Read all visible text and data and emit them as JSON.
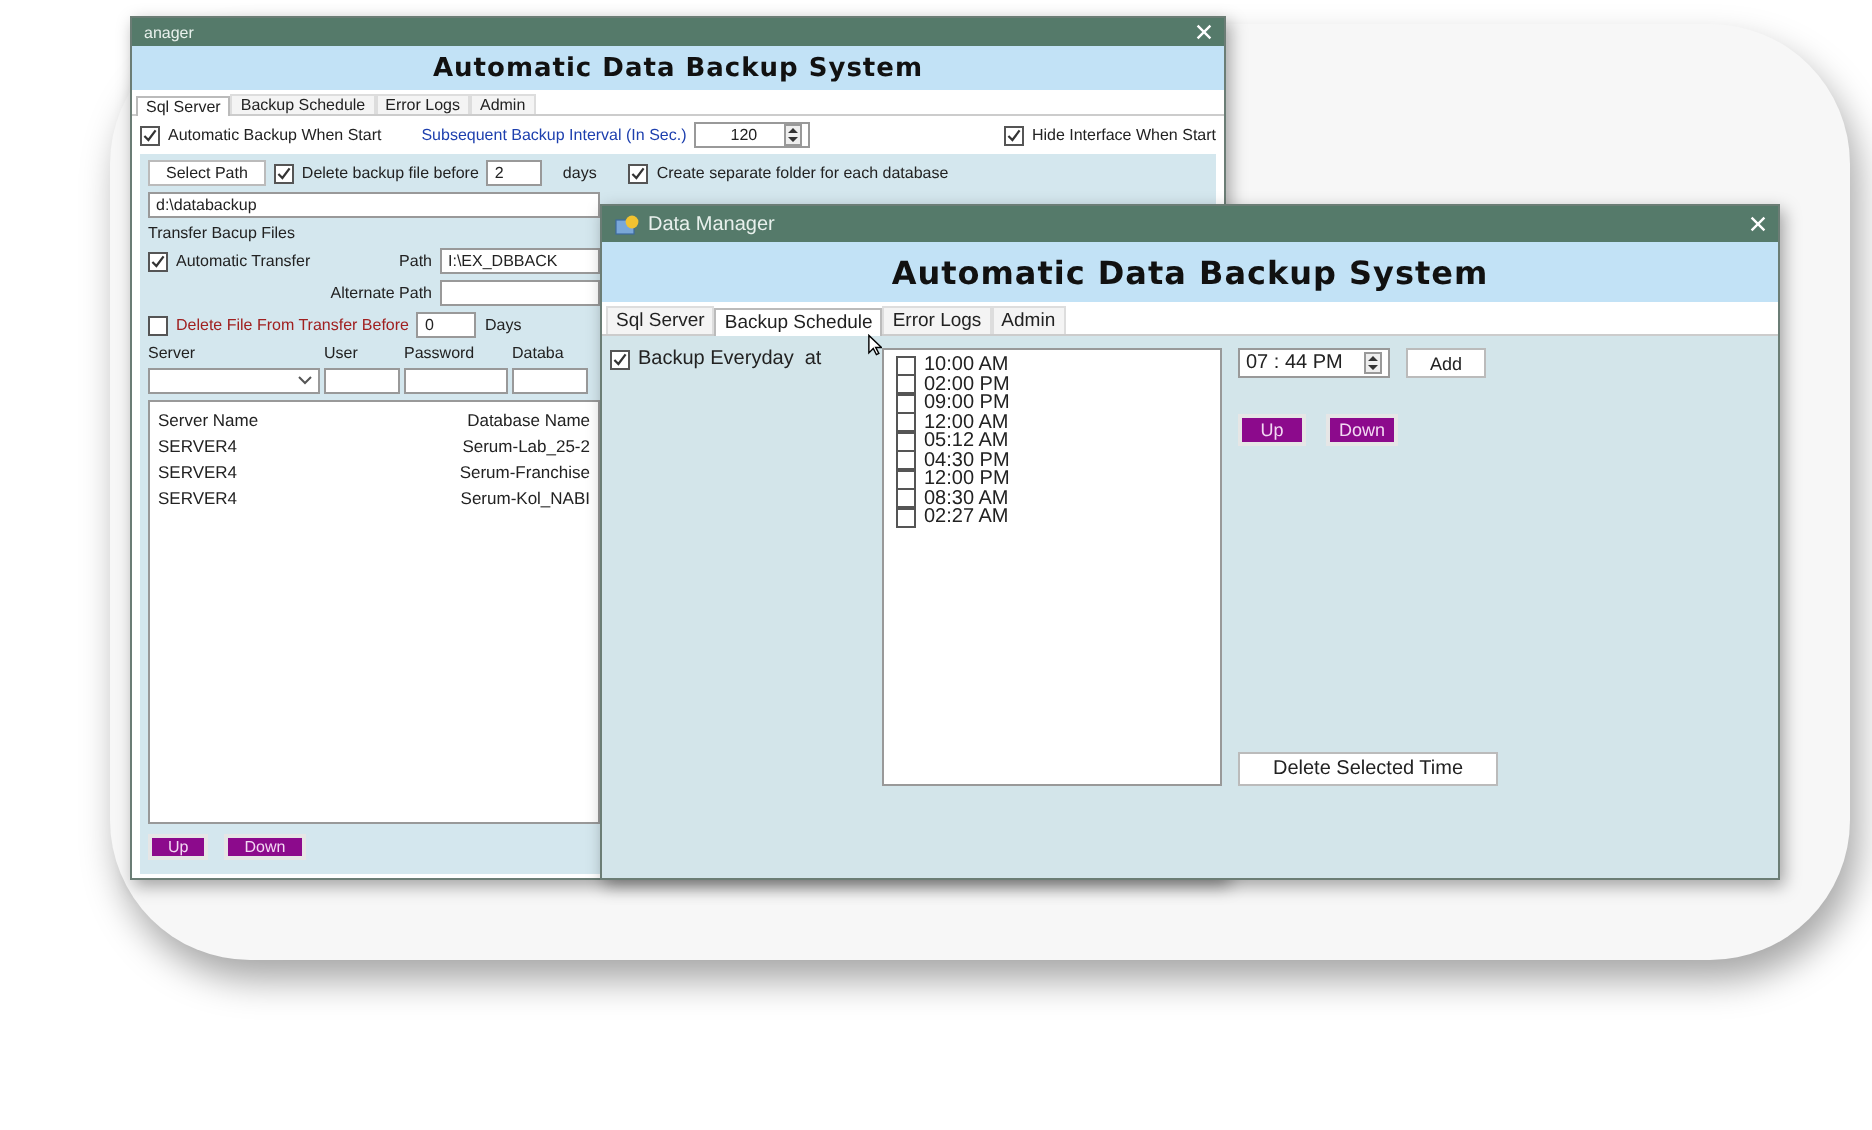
{
  "back_window": {
    "title": "anager",
    "heading": "Automatic Data Backup System",
    "tabs": [
      {
        "label": "Sql Server",
        "selected": true
      },
      {
        "label": "Backup Schedule",
        "selected": false
      },
      {
        "label": "Error Logs",
        "selected": false
      },
      {
        "label": "Admin",
        "selected": false
      }
    ],
    "auto_backup": {
      "label": "Automatic Backup When Start",
      "checked": true
    },
    "interval": {
      "label": "Subsequent Backup Interval (In Sec.)",
      "value": "120"
    },
    "hide_interface": {
      "label": "Hide Interface When Start",
      "checked": true
    },
    "select_path_button": "Select Path",
    "delete_before": {
      "label": "Delete backup file before",
      "checked": true,
      "value": "2",
      "unit": "days"
    },
    "separate_folder": {
      "label": "Create separate folder for each database",
      "checked": true
    },
    "backup_path": "d:\\databackup",
    "transfer": {
      "heading": "Transfer Bacup Files",
      "auto": {
        "label": "Automatic Transfer",
        "checked": true
      },
      "path_label": "Path",
      "path": "I:\\EX_DBBACK",
      "alternate_label": "Alternate Path"
    },
    "delete_transfer": {
      "label": "Delete File From Transfer Before",
      "checked": false,
      "value": "0",
      "unit": "Days"
    },
    "connection_labels": [
      "Server",
      "User",
      "Password",
      "Databa"
    ],
    "list": {
      "server_header": "Server Name",
      "database_header": "Database Name",
      "servers": [
        "SERVER4",
        "SERVER4",
        "SERVER4"
      ],
      "databases": [
        "Serum-Lab_25-2",
        "Serum-Franchise",
        "Serum-Kol_NABI"
      ]
    },
    "buttons": [
      "Up",
      "Down"
    ]
  },
  "front_window": {
    "title": "Data Manager",
    "heading": "Automatic Data Backup System",
    "tabs": [
      {
        "label": "Sql Server",
        "selected": false
      },
      {
        "label": "Backup Schedule",
        "selected": true
      },
      {
        "label": "Error Logs",
        "selected": false
      },
      {
        "label": "Admin",
        "selected": false
      }
    ],
    "backup_everyday": {
      "label": "Backup Everyday  at",
      "checked": true
    },
    "schedule": [
      {
        "time": "10:00 AM",
        "checked": false
      },
      {
        "time": "02:00 PM",
        "checked": false
      },
      {
        "time": "09:00 PM",
        "checked": false
      },
      {
        "time": "12:00 AM",
        "checked": false
      },
      {
        "time": "05:12 AM",
        "checked": false
      },
      {
        "time": "04:30 PM",
        "checked": false
      },
      {
        "time": "12:00 PM",
        "checked": false
      },
      {
        "time": "08:30 AM",
        "checked": false
      },
      {
        "time": "02:27 AM",
        "checked": false
      }
    ],
    "time_value": "07 : 44 PM",
    "add_button": "Add",
    "up_button": "Up",
    "down_button": "Down",
    "delete_button": "Delete Selected Time"
  }
}
